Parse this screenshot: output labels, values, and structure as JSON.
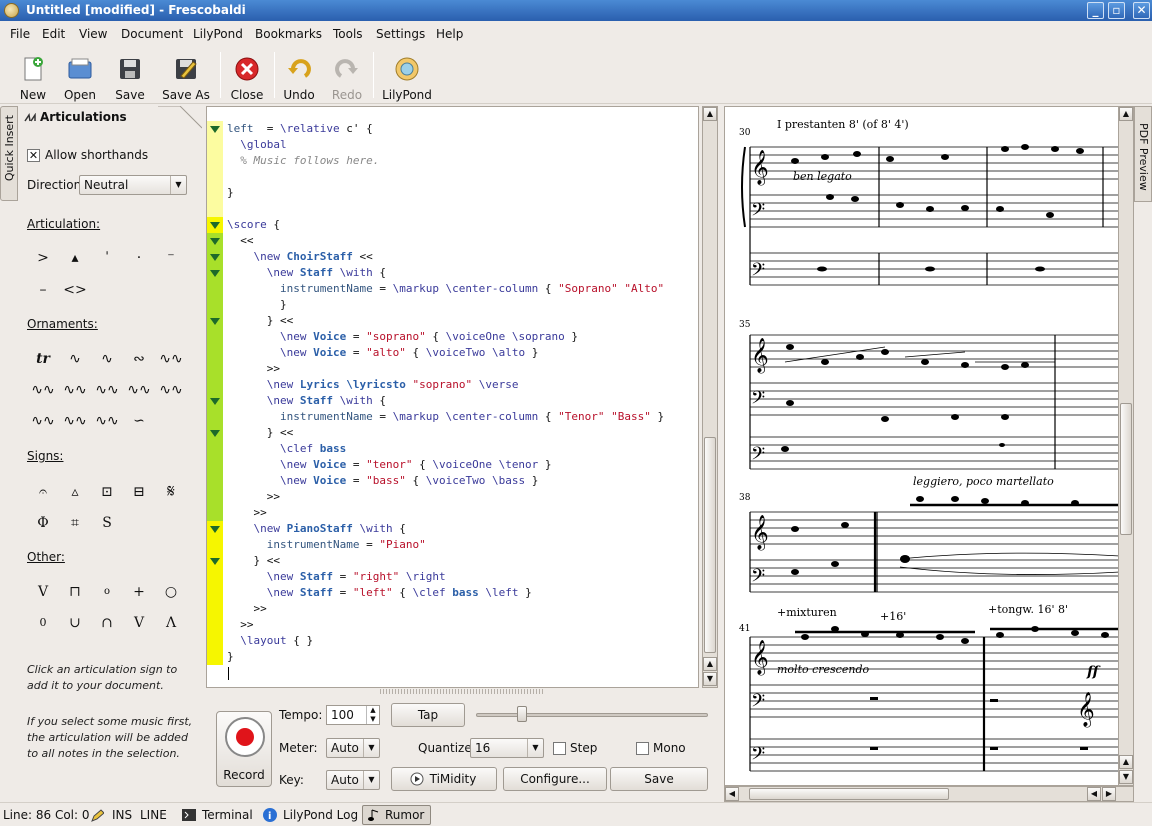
{
  "window": {
    "title": "Untitled [modified] - Frescobaldi"
  },
  "menu": [
    "File",
    "Edit",
    "View",
    "Document",
    "LilyPond",
    "Bookmarks",
    "Tools",
    "Settings",
    "Help"
  ],
  "toolbar": {
    "new": "New",
    "open": "Open",
    "save": "Save",
    "save_as": "Save As",
    "close": "Close",
    "undo": "Undo",
    "redo": "Redo",
    "lilypond": "LilyPond"
  },
  "side_tabs": {
    "quick_insert": "Quick Insert",
    "pdf_preview": "PDF Preview"
  },
  "panel": {
    "title": "Articulations",
    "allow_shorthands": "Allow shorthands",
    "direction_label": "Direction:",
    "direction_value": "Neutral",
    "articulation_label": "Articulation:",
    "ornaments_label": "Ornaments:",
    "signs_label": "Signs:",
    "other_label": "Other:",
    "help1": "Click an articulation sign to add it to your document.",
    "help2": "If you select some music first, the articulation will be added to all notes in the selection."
  },
  "editor": {
    "lines": [
      {
        "seg": [
          [
            "varn",
            "left"
          ],
          [
            "",
            "  = "
          ],
          [
            "cmd",
            "\\relative"
          ],
          [
            "",
            " c' {"
          ]
        ]
      },
      {
        "seg": [
          [
            "",
            "  "
          ],
          [
            "cmd",
            "\\global"
          ]
        ]
      },
      {
        "seg": [
          [
            "cmt",
            "  % Music follows here."
          ]
        ]
      },
      {
        "seg": [
          [
            "",
            ""
          ]
        ]
      },
      {
        "seg": [
          [
            "",
            "}"
          ]
        ]
      },
      {
        "seg": [
          [
            "",
            ""
          ]
        ]
      },
      {
        "seg": [
          [
            "cmd",
            "\\score"
          ],
          [
            "",
            " {"
          ]
        ]
      },
      {
        "seg": [
          [
            "",
            "  <<"
          ]
        ]
      },
      {
        "seg": [
          [
            "",
            "    "
          ],
          [
            "cmd",
            "\\new "
          ],
          [
            "ctx",
            "ChoirStaff"
          ],
          [
            "",
            " <<"
          ]
        ]
      },
      {
        "seg": [
          [
            "",
            "      "
          ],
          [
            "cmd",
            "\\new "
          ],
          [
            "ctx",
            "Staff"
          ],
          [
            "",
            " "
          ],
          [
            "cmd",
            "\\with"
          ],
          [
            "",
            " {"
          ]
        ]
      },
      {
        "seg": [
          [
            "",
            "        "
          ],
          [
            "varn",
            "instrumentName"
          ],
          [
            "",
            " = "
          ],
          [
            "cmd",
            "\\markup \\center-column"
          ],
          [
            "",
            " { "
          ],
          [
            "str",
            "\"Soprano\""
          ],
          [
            "",
            " "
          ],
          [
            "str",
            "\"Alto\""
          ]
        ]
      },
      {
        "seg": [
          [
            "",
            "        }"
          ]
        ]
      },
      {
        "seg": [
          [
            "",
            "      } <<"
          ]
        ]
      },
      {
        "seg": [
          [
            "",
            "        "
          ],
          [
            "cmd",
            "\\new "
          ],
          [
            "ctx",
            "Voice"
          ],
          [
            "",
            " = "
          ],
          [
            "str",
            "\"soprano\""
          ],
          [
            "",
            " { "
          ],
          [
            "cmd",
            "\\voiceOne \\soprano"
          ],
          [
            "",
            " }"
          ]
        ]
      },
      {
        "seg": [
          [
            "",
            "        "
          ],
          [
            "cmd",
            "\\new "
          ],
          [
            "ctx",
            "Voice"
          ],
          [
            "",
            " = "
          ],
          [
            "str",
            "\"alto\""
          ],
          [
            "",
            " { "
          ],
          [
            "cmd",
            "\\voiceTwo \\alto"
          ],
          [
            "",
            " }"
          ]
        ]
      },
      {
        "seg": [
          [
            "",
            "      >>"
          ]
        ]
      },
      {
        "seg": [
          [
            "",
            "      "
          ],
          [
            "cmd",
            "\\new "
          ],
          [
            "ctx",
            "Lyrics \\lyricsto"
          ],
          [
            "",
            " "
          ],
          [
            "str",
            "\"soprano\""
          ],
          [
            "",
            " "
          ],
          [
            "cmd",
            "\\verse"
          ]
        ]
      },
      {
        "seg": [
          [
            "",
            "      "
          ],
          [
            "cmd",
            "\\new "
          ],
          [
            "ctx",
            "Staff"
          ],
          [
            "",
            " "
          ],
          [
            "cmd",
            "\\with"
          ],
          [
            "",
            " {"
          ]
        ]
      },
      {
        "seg": [
          [
            "",
            "        "
          ],
          [
            "varn",
            "instrumentName"
          ],
          [
            "",
            " = "
          ],
          [
            "cmd",
            "\\markup \\center-column"
          ],
          [
            "",
            " { "
          ],
          [
            "str",
            "\"Tenor\""
          ],
          [
            "",
            " "
          ],
          [
            "str",
            "\"Bass\""
          ],
          [
            "",
            " }"
          ]
        ]
      },
      {
        "seg": [
          [
            "",
            "      } <<"
          ]
        ]
      },
      {
        "seg": [
          [
            "",
            "        "
          ],
          [
            "cmd",
            "\\clef "
          ],
          [
            "ctx",
            "bass"
          ]
        ]
      },
      {
        "seg": [
          [
            "",
            "        "
          ],
          [
            "cmd",
            "\\new "
          ],
          [
            "ctx",
            "Voice"
          ],
          [
            "",
            " = "
          ],
          [
            "str",
            "\"tenor\""
          ],
          [
            "",
            " { "
          ],
          [
            "cmd",
            "\\voiceOne \\tenor"
          ],
          [
            "",
            " }"
          ]
        ]
      },
      {
        "seg": [
          [
            "",
            "        "
          ],
          [
            "cmd",
            "\\new "
          ],
          [
            "ctx",
            "Voice"
          ],
          [
            "",
            " = "
          ],
          [
            "str",
            "\"bass\""
          ],
          [
            "",
            " { "
          ],
          [
            "cmd",
            "\\voiceTwo \\bass"
          ],
          [
            "",
            " }"
          ]
        ]
      },
      {
        "seg": [
          [
            "",
            "      >>"
          ]
        ]
      },
      {
        "seg": [
          [
            "",
            "    >>"
          ]
        ]
      },
      {
        "seg": [
          [
            "",
            "    "
          ],
          [
            "cmd",
            "\\new "
          ],
          [
            "ctx",
            "PianoStaff"
          ],
          [
            "",
            " "
          ],
          [
            "cmd",
            "\\with"
          ],
          [
            "",
            " {"
          ]
        ]
      },
      {
        "seg": [
          [
            "",
            "      "
          ],
          [
            "varn",
            "instrumentName"
          ],
          [
            "",
            " = "
          ],
          [
            "str",
            "\"Piano\""
          ]
        ]
      },
      {
        "seg": [
          [
            "",
            "    } <<"
          ]
        ]
      },
      {
        "seg": [
          [
            "",
            "      "
          ],
          [
            "cmd",
            "\\new "
          ],
          [
            "ctx",
            "Staff"
          ],
          [
            "",
            " = "
          ],
          [
            "str",
            "\"right\""
          ],
          [
            "",
            " "
          ],
          [
            "cmd",
            "\\right"
          ]
        ]
      },
      {
        "seg": [
          [
            "",
            "      "
          ],
          [
            "cmd",
            "\\new "
          ],
          [
            "ctx",
            "Staff"
          ],
          [
            "",
            " = "
          ],
          [
            "str",
            "\"left\""
          ],
          [
            "",
            " { "
          ],
          [
            "cmd",
            "\\clef "
          ],
          [
            "ctx",
            "bass"
          ],
          [
            "",
            " "
          ],
          [
            "cmd",
            "\\left"
          ],
          [
            "",
            " }"
          ]
        ]
      },
      {
        "seg": [
          [
            "",
            "    >>"
          ]
        ]
      },
      {
        "seg": [
          [
            "",
            "  >>"
          ]
        ]
      },
      {
        "seg": [
          [
            "",
            "  "
          ],
          [
            "cmd",
            "\\layout"
          ],
          [
            "",
            " { }"
          ]
        ]
      },
      {
        "seg": [
          [
            "",
            "}"
          ]
        ]
      },
      {
        "seg": [
          [
            "",
            ""
          ]
        ]
      }
    ]
  },
  "midi": {
    "record": "Record",
    "tempo_label": "Tempo:",
    "tempo_value": "100",
    "tap": "Tap",
    "meter_label": "Meter:",
    "meter_value": "Auto",
    "quantize_label": "Quantize:",
    "quantize_value": "16",
    "step": "Step",
    "mono": "Mono",
    "key_label": "Key:",
    "key_value": "Auto",
    "timidity": "TiMidity",
    "configure": "Configure...",
    "save": "Save",
    "tempo_slider_fraction": 0.2
  },
  "score": {
    "m30": "30",
    "m35": "35",
    "m38": "38",
    "m41": "41",
    "text1": "I prestanten 8' (of 8' 4')",
    "text2": "ben legato",
    "text3": "leggiero, poco martellato",
    "text4": "+mixturen",
    "text5": "+16'",
    "text6": "+tongw. 16' 8'",
    "text7": "molto crescendo",
    "text8": "ff"
  },
  "status": {
    "pos": "Line: 86 Col: 0",
    "ins": "INS",
    "line": "LINE",
    "terminal": "Terminal",
    "log": "LilyPond Log",
    "rumor": "Rumor"
  }
}
